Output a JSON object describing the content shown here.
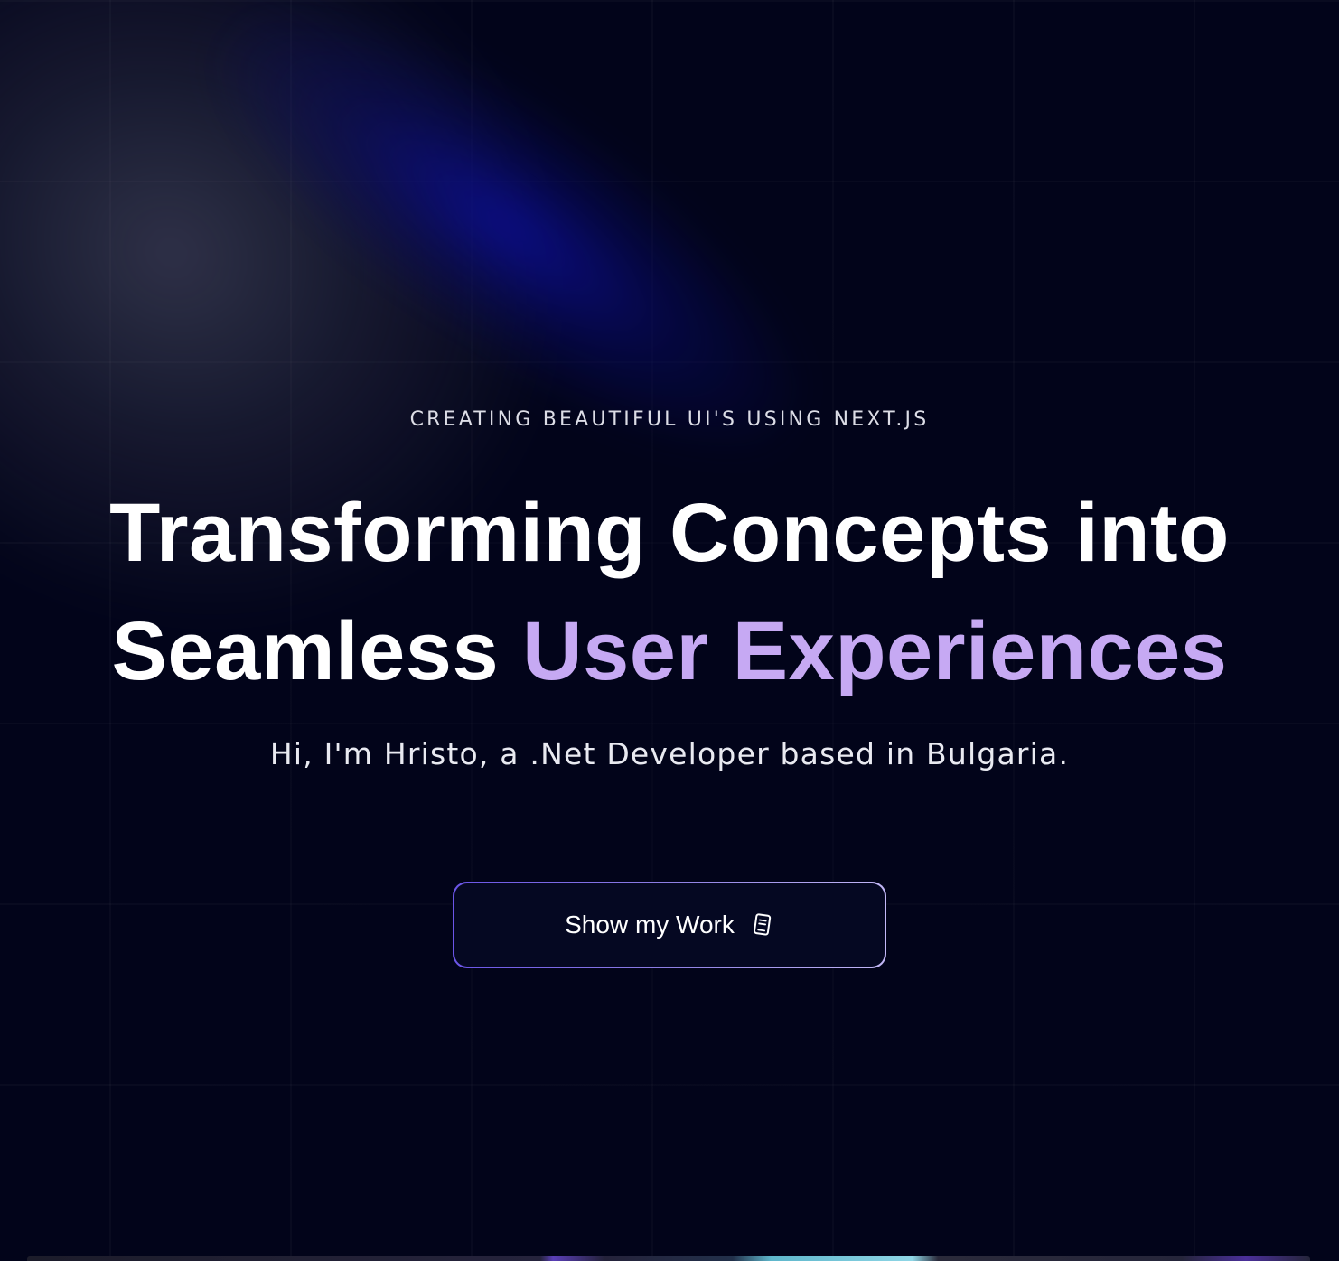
{
  "hero": {
    "eyebrow": "CREATING BEAUTIFUL UI'S USING NEXT.JS",
    "headline_line1": "Transforming Concepts into",
    "headline_line2_plain": "Seamless ",
    "headline_line2_accent": "User Experiences",
    "subline": "Hi, I'm Hristo, a .Net Developer based in Bulgaria.",
    "cta_label": "Show my Work",
    "cta_icon": "document-icon"
  },
  "colors": {
    "background": "#02041a",
    "accent": "#c6a9f3",
    "button_border_start": "#6b55e8",
    "button_border_end": "#c3b8f7",
    "text": "#ffffff"
  }
}
